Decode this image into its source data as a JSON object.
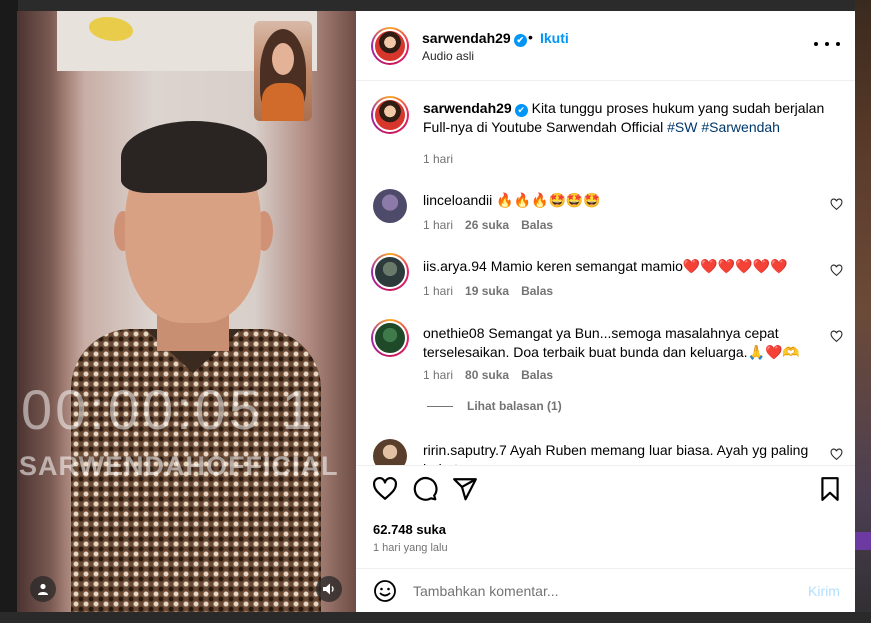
{
  "video": {
    "watermark_time": "00:00:05 1",
    "watermark_name": "SARWENDAHOFFICIAL",
    "user_icon": "user-icon",
    "audio_icon": "speaker-icon"
  },
  "header": {
    "username": "sarwendah29",
    "verified": "✔",
    "separator": "•",
    "follow_label": "Ikuti",
    "audio_label": "Audio asli",
    "more_icon": "more-horizontal-icon"
  },
  "caption": {
    "username": "sarwendah29",
    "text": "Kita tunggu proses hukum yang sudah berjalan Full-nya di Youtube Sarwendah Official",
    "tags": [
      "#SW",
      "#Sarwendah"
    ],
    "time": "1 hari"
  },
  "comments": [
    {
      "username": "linceloandii",
      "text": "🔥🔥🔥🤩🤩🤩",
      "time": "1 hari",
      "likes": "26 suka",
      "reply": "Balas"
    },
    {
      "username": "iis.arya.94",
      "text": "Mamio keren semangat mamio❤️❤️❤️❤️❤️❤️",
      "time": "1 hari",
      "likes": "19 suka",
      "reply": "Balas"
    },
    {
      "username": "onethie08",
      "text": "Semangat ya Bun...semoga masalahnya cepat terselesaikan. Doa terbaik buat bunda dan keluarga.🙏❤️🫶",
      "time": "1 hari",
      "likes": "80 suka",
      "reply": "Balas"
    },
    {
      "username": "ririn.saputry.7",
      "text": "Ayah Ruben memang luar biasa. Ayah yg paling hebat",
      "time": "",
      "likes": "",
      "reply": ""
    }
  ],
  "view_replies": "Lihat balasan (1)",
  "actions": {
    "like_icon": "heart-icon",
    "comment_icon": "comment-icon",
    "share_icon": "send-icon",
    "save_icon": "bookmark-icon",
    "likes": "62.748 suka",
    "time_ago": "1 hari yang lalu"
  },
  "add_comment": {
    "emoji_icon": "emoji-icon",
    "placeholder": "Tambahkan komentar...",
    "post_label": "Kirim"
  },
  "colors": {
    "accent": "#0095f6",
    "tag": "#00376b",
    "muted": "#737373",
    "post_disabled": "#b2dffc"
  }
}
